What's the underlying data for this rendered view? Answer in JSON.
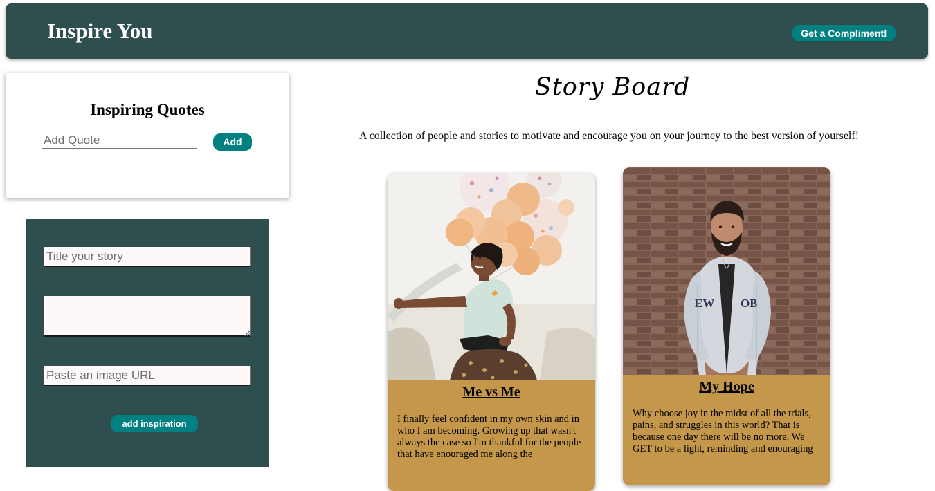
{
  "header": {
    "brand": "Inspire You",
    "compliment_label": "Get a Compliment!"
  },
  "quotes": {
    "title": "Inspiring Quotes",
    "input_placeholder": "Add Quote",
    "add_label": "Add"
  },
  "story_form": {
    "title_placeholder": "Title your story",
    "story_placeholder": "",
    "image_placeholder": "Paste an image URL",
    "submit_label": "add inspiration"
  },
  "board": {
    "title": "Story Board",
    "subtitle": "A collection of people and stories to motivate and encourage you on your journey to the best version of yourself!"
  },
  "stories": [
    {
      "title": "Me vs Me",
      "text": "I finally feel confident in my own skin and in who I am becoming. Growing up that wasn't always the case so I'm thankful for the people that have enouraged me along the"
    },
    {
      "title": "My Hope",
      "text": "Why choose joy in the midst of all the trials, pains, and struggles in this world? That is because one day there will be no more. We GET to be a light, reminding and enouraging"
    }
  ],
  "colors": {
    "header_bg": "#2f4f4f",
    "accent": "#008080",
    "card_body": "#c4974a",
    "field_bg": "#fff8f8"
  }
}
